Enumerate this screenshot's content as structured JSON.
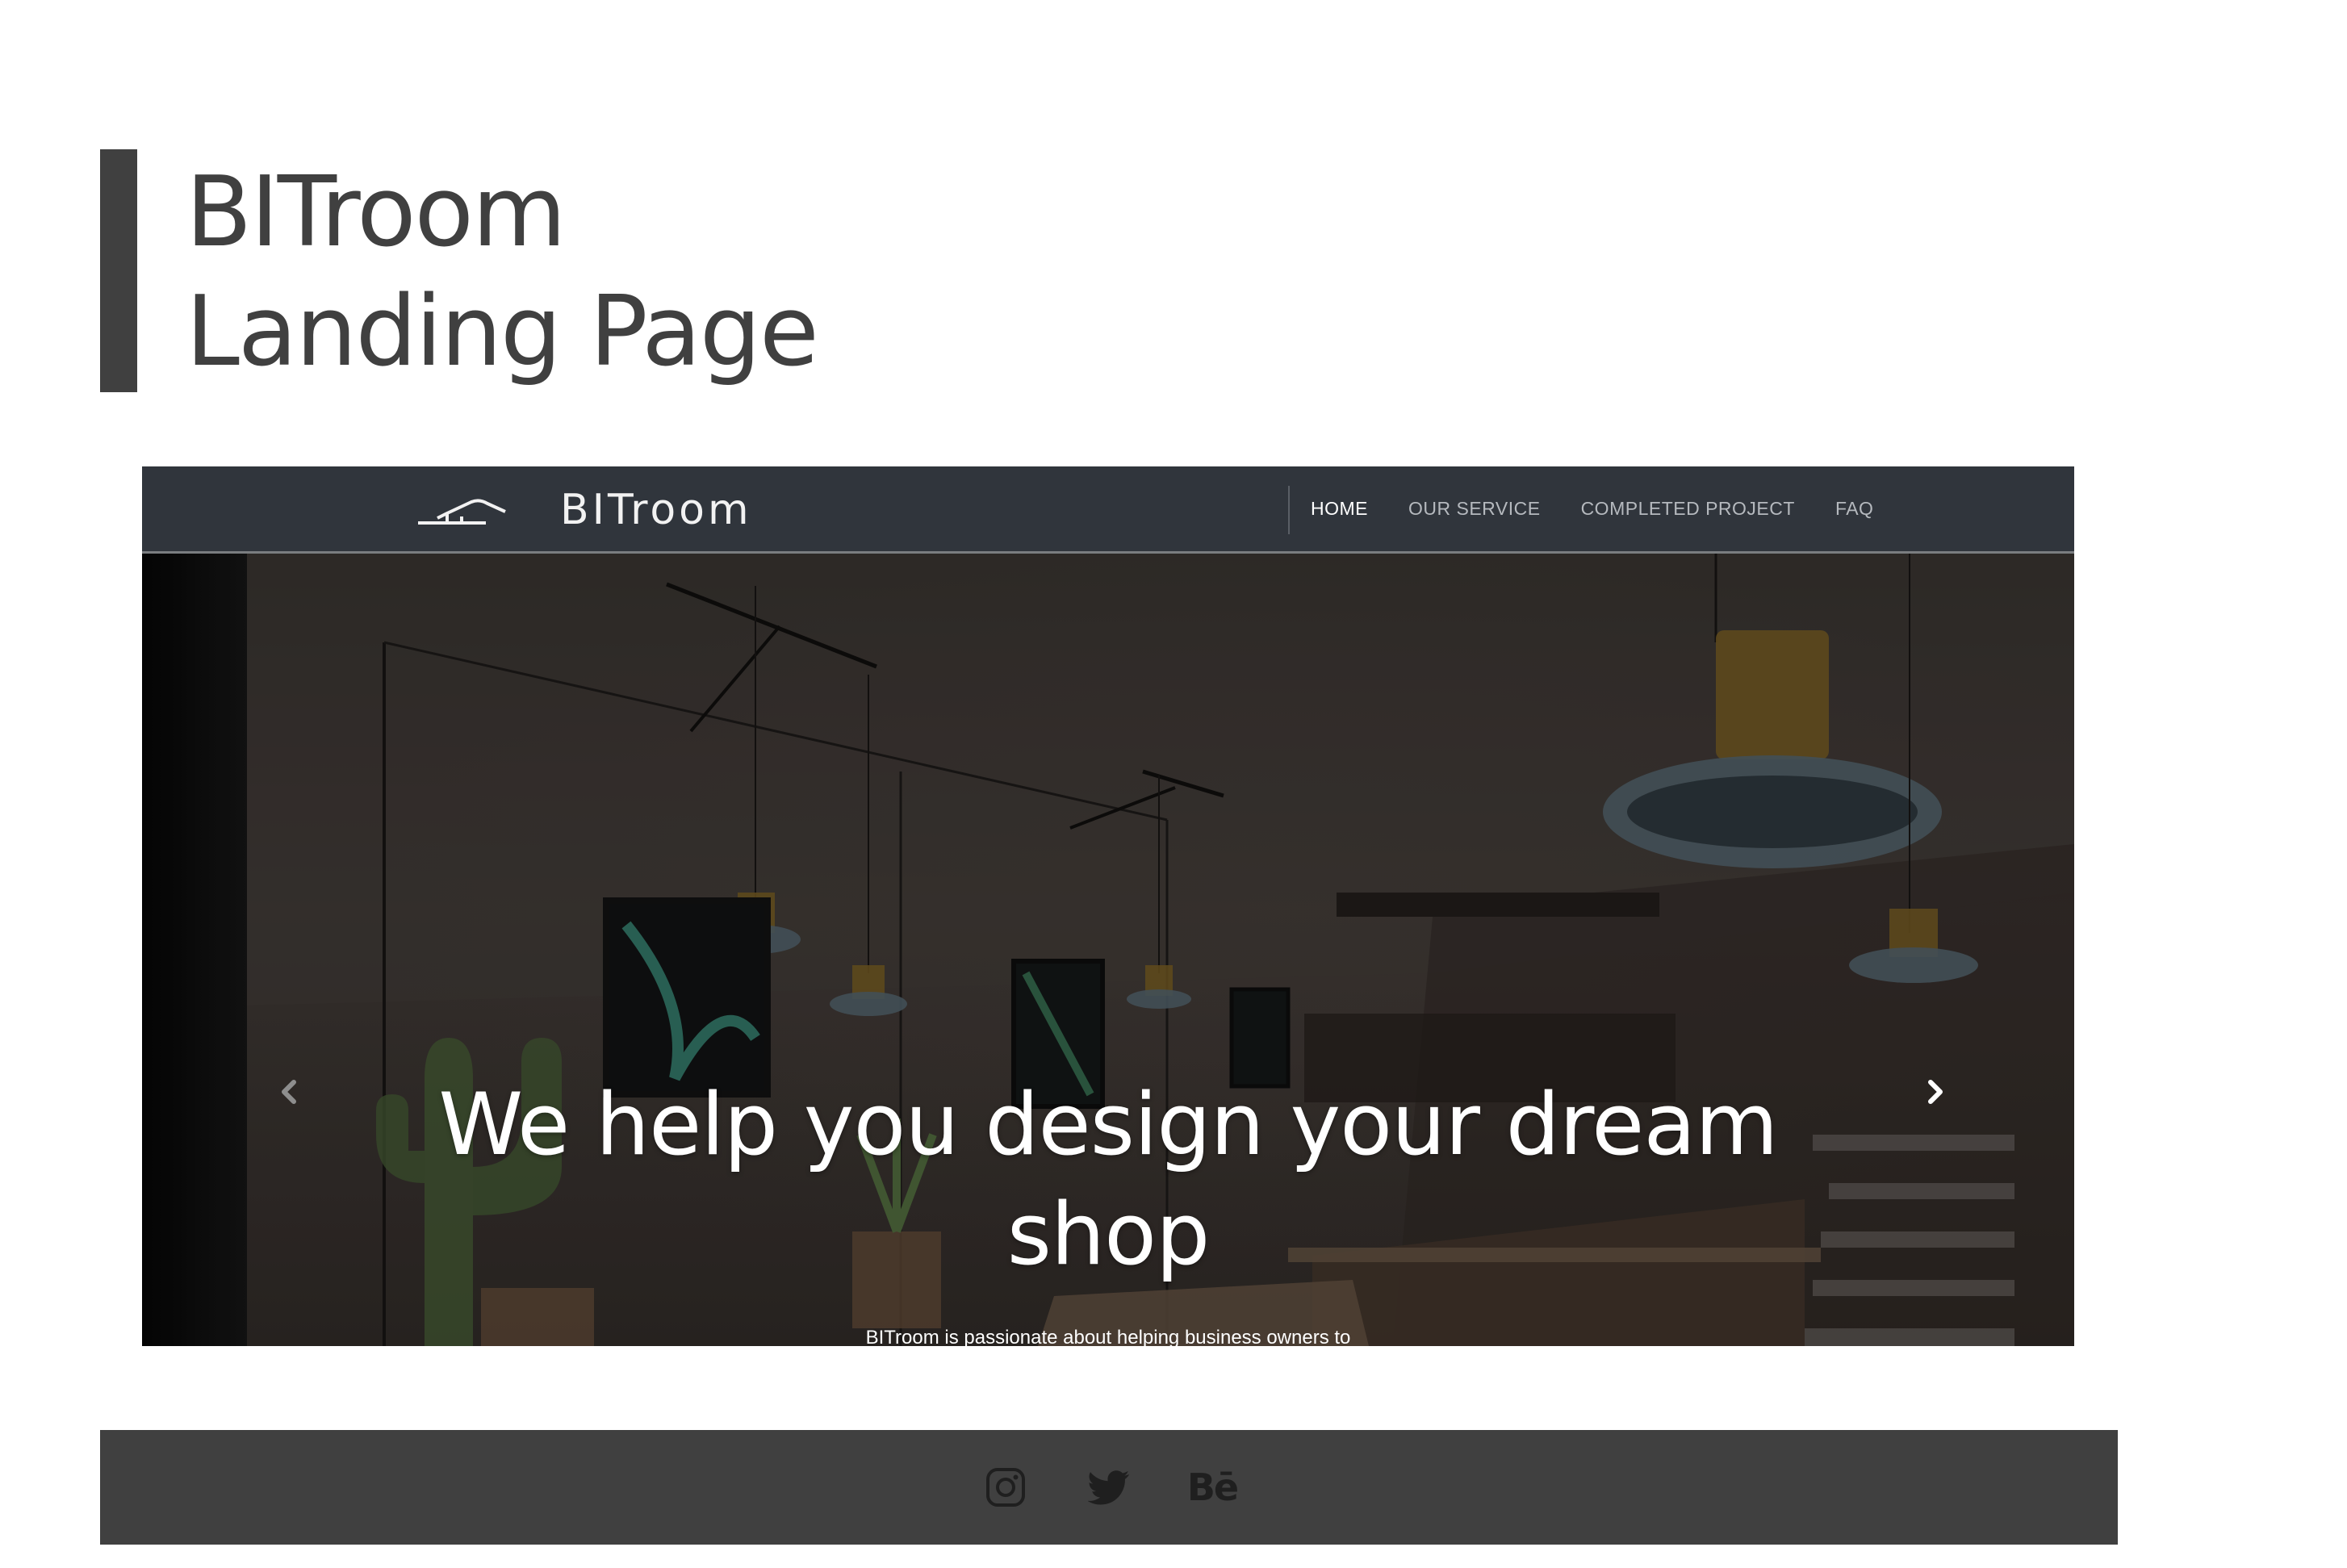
{
  "title": {
    "line1": "BITroom",
    "line2": "Landing Page"
  },
  "site": {
    "logo_text": "BITroom",
    "nav": [
      {
        "label": "HOME",
        "active": true
      },
      {
        "label": "OUR SERVICE",
        "active": false
      },
      {
        "label": "COMPLETED PROJECT",
        "active": false
      },
      {
        "label": "FAQ",
        "active": false
      }
    ],
    "hero": {
      "heading_line1": "We help you design your dream",
      "heading_line2": "shop",
      "subtext": "BITroom is passionate about helping business owners to"
    }
  },
  "footer": {
    "social_icons": [
      "instagram-icon",
      "twitter-icon",
      "behance-icon"
    ],
    "behance_text": "Bē"
  },
  "colors": {
    "accent_bar": "#404040",
    "navbar": "#30353c",
    "footer": "#404040",
    "icon": "#1f1f1f"
  }
}
